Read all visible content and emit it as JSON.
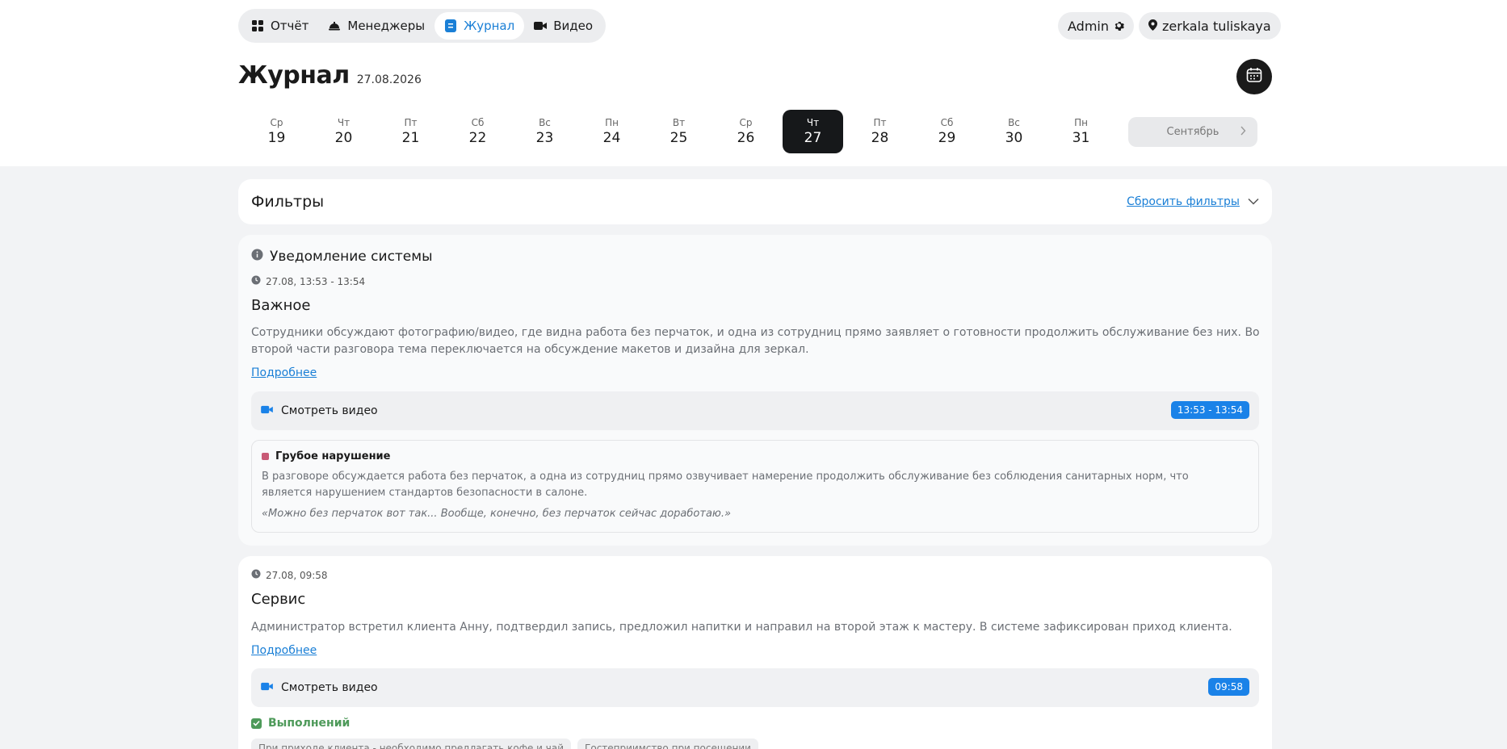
{
  "nav": [
    {
      "label": "Отчёт",
      "icon": "grid-icon",
      "active": false
    },
    {
      "label": "Менеджеры",
      "icon": "cloche-icon",
      "active": false
    },
    {
      "label": "Журнал",
      "icon": "journal-icon",
      "active": true
    },
    {
      "label": "Видео",
      "icon": "video-camera-icon",
      "active": false
    }
  ],
  "header": {
    "admin_label": "Admin",
    "location_label": "zerkala tuliskaya"
  },
  "page": {
    "title": "Журнал",
    "date": "27.08.2026"
  },
  "days": [
    {
      "wd": "Ср",
      "dn": "19"
    },
    {
      "wd": "Чт",
      "dn": "20"
    },
    {
      "wd": "Пт",
      "dn": "21"
    },
    {
      "wd": "Сб",
      "dn": "22"
    },
    {
      "wd": "Вс",
      "dn": "23"
    },
    {
      "wd": "Пн",
      "dn": "24"
    },
    {
      "wd": "Вт",
      "dn": "25"
    },
    {
      "wd": "Ср",
      "dn": "26"
    },
    {
      "wd": "Чт",
      "dn": "27",
      "active": true
    },
    {
      "wd": "Пт",
      "dn": "28"
    },
    {
      "wd": "Сб",
      "dn": "29"
    },
    {
      "wd": "Вс",
      "dn": "30"
    },
    {
      "wd": "Пн",
      "dn": "31"
    }
  ],
  "month_button": "Сентябрь",
  "filters": {
    "title": "Фильтры",
    "reset": "Сбросить фильтры"
  },
  "events": [
    {
      "system_label": "Уведомление системы",
      "time": "27.08, 13:53 - 13:54",
      "category": "Важное",
      "description": "Сотрудники обсуждают фотографию/видео, где видна работа без перчаток, и одна из сотрудниц прямо заявляет о готовности продолжить обслуживание без них. Во второй части разговора тема переключается на обсуждение макетов и дизайна для зеркал.",
      "more": "Подробнее",
      "video_label": "Смотреть видео",
      "video_badge": "13:53 - 13:54",
      "violation": {
        "title": "Грубое нарушение",
        "text": "В разговоре обсуждается работа без перчаток, а одна из сотрудниц прямо озвучивает намерение продолжить обслуживание без соблюдения санитарных норм, что является нарушением стандартов безопасности в салоне.",
        "quote": "«Можно без перчаток вот так... Вообще, конечно, без перчаток сейчас доработаю.»"
      }
    },
    {
      "time": "27.08, 09:58",
      "category": "Сервис",
      "description": "Администратор встретил клиента Анну, подтвердил запись, предложил напитки и направил на второй этаж к мастеру. В системе зафиксирован приход клиента.",
      "more": "Подробнее",
      "video_label": "Смотреть видео",
      "video_badge": "09:58",
      "done_label": "Выполнений",
      "tags": [
        "При приходе клиента - необходимо предлагать кофе и чай",
        "Гостеприимство при посещении"
      ]
    }
  ],
  "colors": {
    "accent": "#1a7fd6",
    "badge": "#1a82e8",
    "violation": "#c85a76",
    "done": "#4e9a5a"
  }
}
